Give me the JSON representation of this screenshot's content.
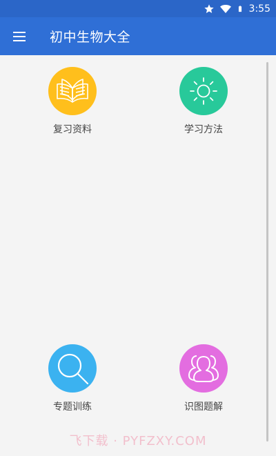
{
  "status_bar": {
    "time": "3:55",
    "icons": [
      "star-icon",
      "wifi-icon",
      "battery-icon"
    ]
  },
  "app_bar": {
    "title": "初中生物大全",
    "menu_icon": "menu-icon"
  },
  "grid": {
    "items": [
      {
        "label": "复习资料",
        "icon": "book-icon",
        "color": "#ffbf1c"
      },
      {
        "label": "学习方法",
        "icon": "sun-icon",
        "color": "#28c99a"
      },
      {
        "label": "专题训练",
        "icon": "search-icon",
        "color": "#3bb2f0"
      },
      {
        "label": "识图题解",
        "icon": "users-icon",
        "color": "#e36de0"
      }
    ]
  },
  "watermark": "飞下载 · PYFZXY.COM",
  "colors": {
    "status_bar": "#2b66c8",
    "app_bar": "#2f6fd6",
    "background": "#f4f4f4"
  }
}
